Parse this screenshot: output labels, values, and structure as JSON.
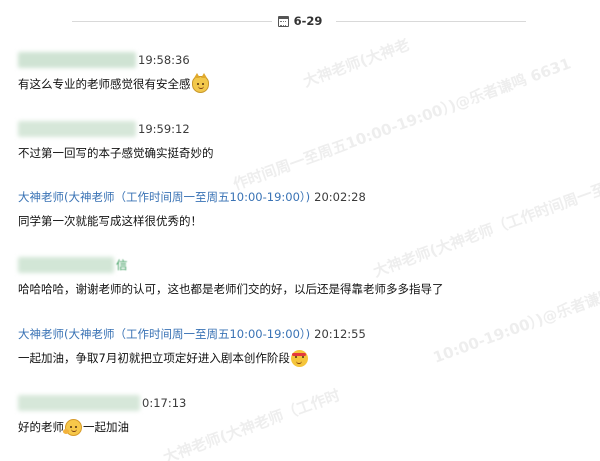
{
  "date_separator": {
    "icon": "calendar-icon",
    "text": "6-29"
  },
  "messages": [
    {
      "sender_blurred": true,
      "blur_color": "#cfe3d3",
      "time": "19:58:36",
      "text": "有这么专业的老师感觉很有安全感",
      "emoji": "cat-smile-icon"
    },
    {
      "sender_blurred": true,
      "blur_color": "#cfe3d3",
      "time": "19:59:12",
      "text": "不过第一回写的本子感觉确实挺奇妙的"
    },
    {
      "sender": "大神老师(大神老师（工作时间周一至周五10:00-19:00）)",
      "time": "20:02:28",
      "text": "同学第一次就能写成这样很优秀的！"
    },
    {
      "sender_blurred": true,
      "blur_color": "#cfe3d3",
      "sender_suffix": "信",
      "text": "哈哈哈哈，谢谢老师的认可，这也都是老师们交的好，以后还是得靠老师多多指导了"
    },
    {
      "sender": "大神老师(大神老师（工作时间周一至周五10:00-19:00）)",
      "time": "20:12:55",
      "text": "一起加油，争取7月初就把立项定好进入剧本创作阶段",
      "emoji": "fighting-icon"
    },
    {
      "sender_blurred": true,
      "blur_color": "#cfe3d3",
      "time": "0:17:13",
      "text_before": "好的老师",
      "emoji": "hug-icon",
      "text_after": "一起加油"
    }
  ],
  "watermarks": [
    {
      "text": "大神老师(大神老"
    },
    {
      "text": "作时间周一至周五10:00-19:00）)@乐者谦鸣 6631"
    },
    {
      "text": "大神老师(大神老师（工作时间周一至"
    },
    {
      "text": "10:00-19:00）)@乐者谦鸣 6631"
    },
    {
      "text": "大神老师(大神老师（工作时"
    }
  ]
}
